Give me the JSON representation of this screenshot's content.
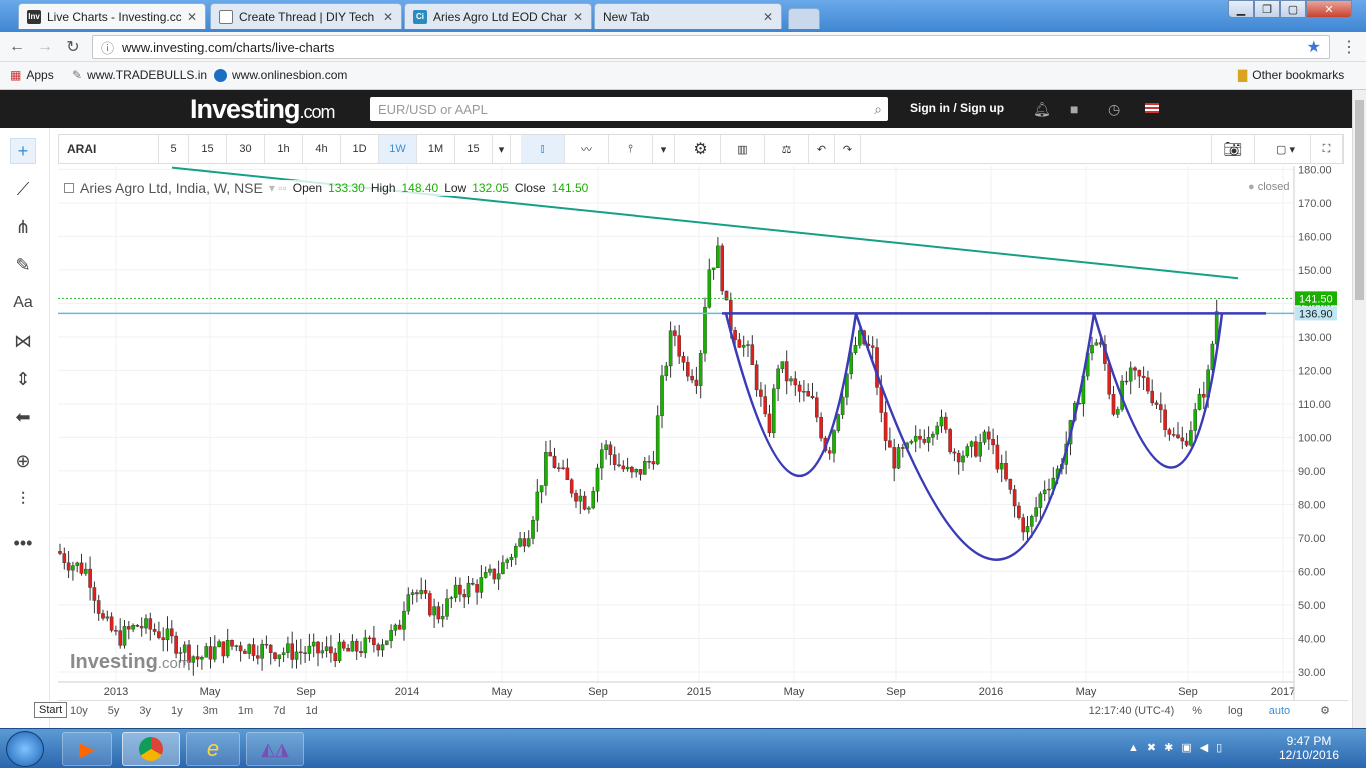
{
  "browser": {
    "tabs": [
      {
        "title": "Live Charts - Investing.cc",
        "favicon": "Inv",
        "active": true
      },
      {
        "title": "Create Thread | DIY Tech",
        "favicon": "",
        "active": false
      },
      {
        "title": "Aries Agro Ltd EOD Char",
        "favicon": "Ci",
        "active": false
      },
      {
        "title": "New Tab",
        "favicon": "",
        "active": false
      }
    ],
    "url": "www.investing.com/charts/live-charts",
    "bookmarks": [
      {
        "label": "Apps",
        "icon": "apps-grid-icon"
      },
      {
        "label": "www.TRADEBULLS.in",
        "icon": "bookmark-icon"
      },
      {
        "label": "www.onlinesbion.com",
        "icon": "bookmark-icon"
      }
    ],
    "other_bookmarks": "Other bookmarks"
  },
  "site": {
    "logo_main": "Investing",
    "logo_suffix": ".com",
    "search_placeholder": "EUR/USD or AAPL",
    "sign_in": "Sign in",
    "sign_sep": "/",
    "sign_up": "Sign up"
  },
  "toolbar": {
    "symbol": "ARAI",
    "intervals": [
      "5",
      "15",
      "30",
      "1h",
      "4h",
      "1D",
      "1W",
      "1M",
      "15"
    ],
    "selected_interval": "1W"
  },
  "legend": {
    "name": "Aries Agro Ltd, India, W, NSE",
    "open_label": "Open",
    "open": "133.30",
    "high_label": "High",
    "high": "148.40",
    "low_label": "Low",
    "low": "132.05",
    "close_label": "Close",
    "close": "141.50",
    "status": "closed"
  },
  "chart_data": {
    "type": "candlestick",
    "y_ticks": [
      "180.00",
      "170.00",
      "160.00",
      "150.00",
      "140.00",
      "130.00",
      "120.00",
      "110.00",
      "100.00",
      "90.00",
      "80.00",
      "70.00",
      "60.00",
      "50.00",
      "40.00",
      "30.00"
    ],
    "ylim": [
      27,
      181
    ],
    "x_ticks": [
      "2013",
      "May",
      "Sep",
      "2014",
      "May",
      "Sep",
      "2015",
      "May",
      "Sep",
      "2016",
      "May",
      "Sep",
      "2017"
    ],
    "price_label_last": "141.50",
    "price_label_line": "136.90",
    "watermark_main": "Investing",
    "watermark_suffix": ".com",
    "colors": {
      "up": "#19b000",
      "down": "#e0201e",
      "trend": "#14a085",
      "pattern": "#3b3bb8",
      "hline": "#5bc0de"
    }
  },
  "bottom": {
    "ranges": [
      "10y",
      "5y",
      "3y",
      "1y",
      "3m",
      "1m",
      "7d",
      "1d"
    ],
    "time": "12:17:40 (UTC-4)",
    "pct": "%",
    "log": "log",
    "auto": "auto"
  },
  "taskbar": {
    "tooltip": "Start",
    "time": "9:47 PM",
    "date": "12/10/2016"
  }
}
